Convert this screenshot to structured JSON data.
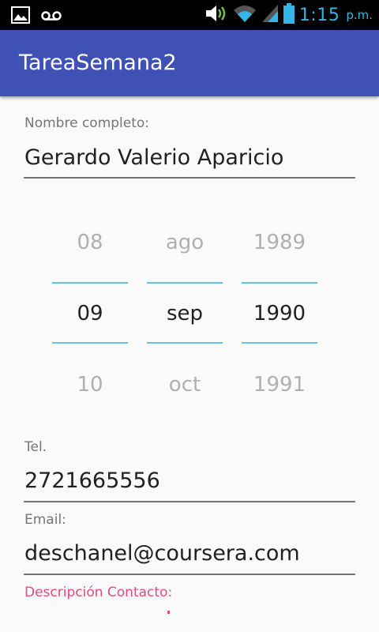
{
  "status_bar": {
    "icons_left": [
      "image-icon",
      "voicemail-icon"
    ],
    "icons_right": [
      "volume-icon",
      "wifi-icon",
      "signal-icon",
      "battery-icon"
    ],
    "time": "1:15",
    "ampm": "p.m."
  },
  "app_bar": {
    "title": "TareaSemana2"
  },
  "form": {
    "name_label": "Nombre completo:",
    "name_value": "Gerardo Valerio Aparicio",
    "date_picker": {
      "day": {
        "prev": "08",
        "selected": "09",
        "next": "10"
      },
      "month": {
        "prev": "ago",
        "selected": "sep",
        "next": "oct"
      },
      "year": {
        "prev": "1989",
        "selected": "1990",
        "next": "1991"
      }
    },
    "tel_label": "Tel.",
    "tel_value": "2721665556",
    "email_label": "Email:",
    "email_value": "deschanel@coursera.com",
    "description_label": "Descripción Contacto:",
    "description_value": ""
  },
  "colors": {
    "primary": "#3f51b5",
    "accent": "#e84a80",
    "picker_divider": "#67c3e3",
    "status_text": "#33b5e5"
  }
}
